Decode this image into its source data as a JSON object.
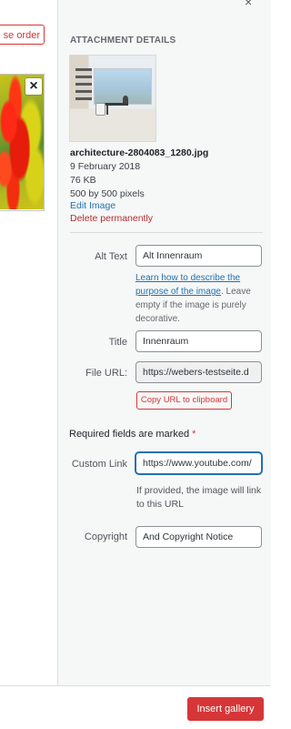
{
  "gallery": {
    "reverse_order_label": "se order",
    "remove_icon": "×"
  },
  "close_icon": "×",
  "attachment": {
    "section_title": "ATTACHMENT DETAILS",
    "filename": "architecture-2804083_1280.jpg",
    "date": "9 February 2018",
    "filesize": "76 KB",
    "dimensions": "500 by 500 pixels",
    "edit_label": "Edit Image",
    "delete_label": "Delete permanently"
  },
  "fields": {
    "alt_text": {
      "label": "Alt Text",
      "value": "Alt Innenraum",
      "help_link": "Learn how to describe the purpose of the image",
      "help_rest": ". Leave empty if the image is purely decorative."
    },
    "title": {
      "label": "Title",
      "value": "Innenraum"
    },
    "file_url": {
      "label": "File URL:",
      "value": "https://webers-testseite.d",
      "copy_label": "Copy URL to clipboard"
    },
    "required_note": "Required fields are marked ",
    "required_star": "*",
    "custom_link": {
      "label": "Custom Link",
      "value": "https://www.youtube.com/",
      "help": "If provided, the image will link to this URL"
    },
    "copyright": {
      "label": "Copyright",
      "value": "And Copyright Notice"
    }
  },
  "footer": {
    "insert_label": "Insert gallery"
  },
  "colors": {
    "accent_red": "#d63638",
    "link_blue": "#2271b1",
    "delete_red": "#b32d2e"
  }
}
